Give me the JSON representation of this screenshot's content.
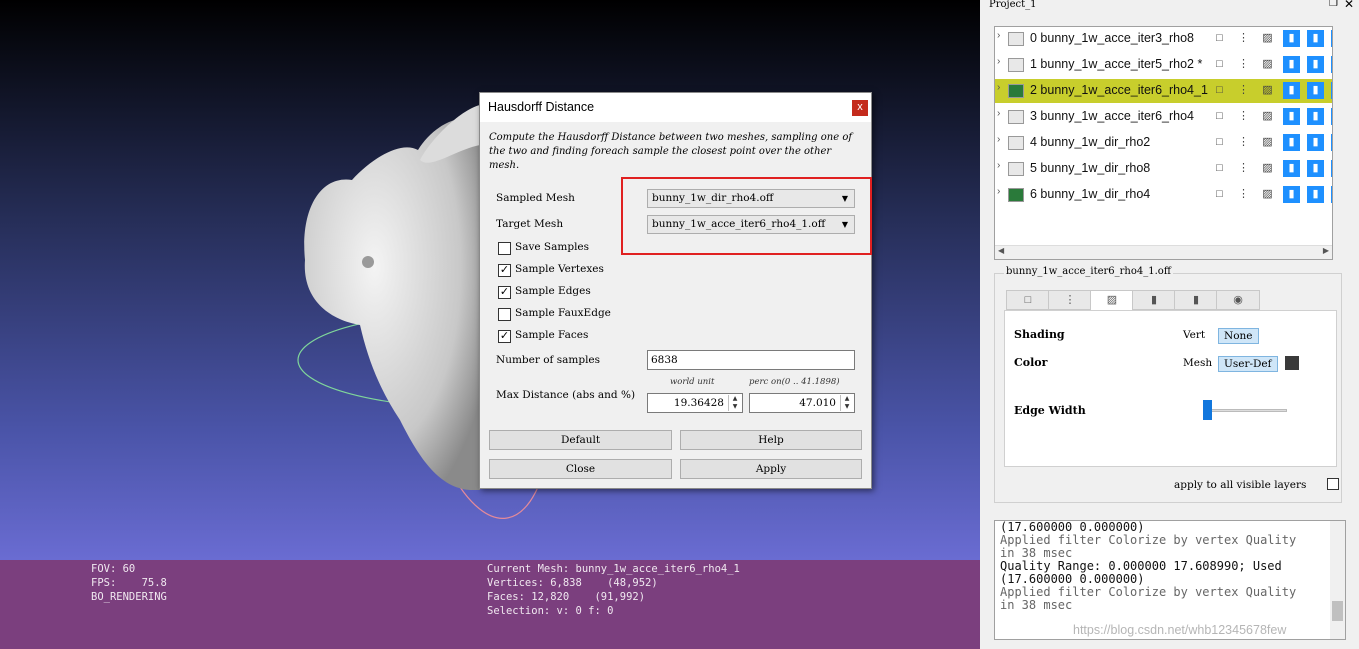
{
  "viewport": {
    "info_left": [
      "FOV: 60",
      "FPS:    75.8",
      "BO_RENDERING"
    ],
    "info_right": [
      "Current Mesh: bunny_1w_acce_iter6_rho4_1",
      "Vertices: 6,838    (48,952)",
      "Faces: 12,820    (91,992)",
      "Selection: v: 0 f: 0"
    ]
  },
  "dialog": {
    "title": "Hausdorff Distance",
    "close": "x",
    "description": "Compute the Hausdorff Distance between two meshes, sampling one of the two and finding foreach sample the closest point over the other mesh.",
    "sampled_mesh_label": "Sampled Mesh",
    "sampled_mesh_value": "bunny_1w_dir_rho4.off",
    "target_mesh_label": "Target Mesh",
    "target_mesh_value": "bunny_1w_acce_iter6_rho4_1.off",
    "checkboxes": [
      {
        "label": "Save Samples",
        "checked": false
      },
      {
        "label": "Sample Vertexes",
        "checked": true
      },
      {
        "label": "Sample Edges",
        "checked": true
      },
      {
        "label": "Sample FauxEdge",
        "checked": false
      },
      {
        "label": "Sample Faces",
        "checked": true
      }
    ],
    "num_samples_label": "Number of samples",
    "num_samples_value": "6838",
    "max_dist_label": "Max Distance (abs and %)",
    "world_unit_label": "world unit",
    "perc_label": "perc on(0 .. 41.1898)",
    "world_unit_value": "19.36428",
    "perc_value": "47.010",
    "buttons": {
      "default": "Default",
      "help": "Help",
      "close": "Close",
      "apply": "Apply"
    }
  },
  "panel": {
    "title": "Project_1",
    "layers": [
      {
        "id": "0",
        "name": "bunny_1w_acce_iter3_rho8",
        "selected": false,
        "active": false
      },
      {
        "id": "1",
        "name": "bunny_1w_acce_iter5_rho2 *",
        "selected": false,
        "active": false
      },
      {
        "id": "2",
        "name": "bunny_1w_acce_iter6_rho4_1",
        "selected": true,
        "active": true
      },
      {
        "id": "3",
        "name": "bunny_1w_acce_iter6_rho4",
        "selected": false,
        "active": false
      },
      {
        "id": "4",
        "name": "bunny_1w_dir_rho2",
        "selected": false,
        "active": false
      },
      {
        "id": "5",
        "name": "bunny_1w_dir_rho8",
        "selected": false,
        "active": false
      },
      {
        "id": "6",
        "name": "bunny_1w_dir_rho4",
        "selected": false,
        "active": true
      }
    ],
    "decoration_title": "bunny_1w_acce_iter6_rho4_1.off",
    "shading_label": "Shading",
    "vert_label": "Vert",
    "vert_value": "None",
    "color_label": "Color",
    "mesh_label": "Mesh",
    "mesh_value": "User-Def",
    "edge_width_label": "Edge Width",
    "apply_all_label": "apply to all visible layers",
    "log": [
      {
        "text": "(17.600000 0.000000)",
        "style": "ok"
      },
      {
        "text": "Applied filter Colorize by vertex Quality",
        "style": "gray"
      },
      {
        "text": "in 38 msec",
        "style": "gray"
      },
      {
        "text": "Quality Range: 0.000000 17.608990; Used",
        "style": "ok"
      },
      {
        "text": "(17.600000 0.000000)",
        "style": "ok"
      },
      {
        "text": "Applied filter Colorize by vertex Quality",
        "style": "gray"
      },
      {
        "text": "in 38 msec",
        "style": "gray"
      }
    ]
  },
  "watermark": "https://blog.csdn.net/whb12345678few"
}
